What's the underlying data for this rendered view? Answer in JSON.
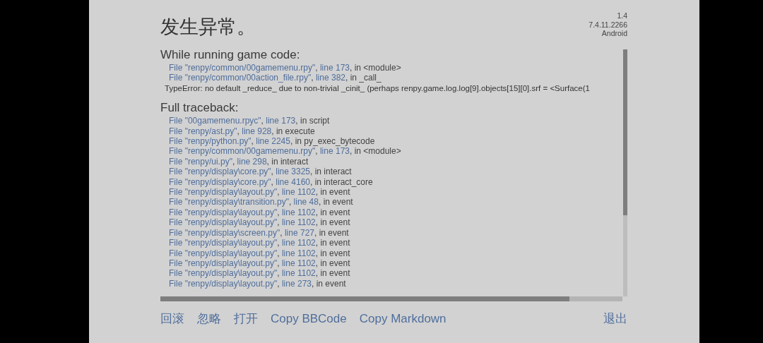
{
  "title": "发生异常。",
  "version_lines": [
    "1.4",
    "7.4.11.2266",
    "Android"
  ],
  "sections": [
    {
      "heading": "While running game code:",
      "frames": [
        {
          "file": "File \"renpy/common/00gamemenu.rpy\"",
          "sep": ", ",
          "line": "line 173",
          "where": ", in <module>"
        },
        {
          "file": "File \"renpy/common/00action_file.rpy\"",
          "sep": ", ",
          "line": "line 382",
          "where": ", in _call_"
        }
      ],
      "message": "TypeError: no default _reduce_ due to non-trivial _cinit_ (perhaps renpy.game.log.log[9].objects[15][0].srf = <Surface(1"
    },
    {
      "heading": "Full traceback:",
      "frames": [
        {
          "file": "File \"00gamemenu.rpyc\"",
          "sep": ", ",
          "line": "line 173",
          "where": ", in script"
        },
        {
          "file": "File \"renpy/ast.py\"",
          "sep": ", ",
          "line": "line 928",
          "where": ", in execute"
        },
        {
          "file": "File \"renpy/python.py\"",
          "sep": ", ",
          "line": "line 2245",
          "where": ", in py_exec_bytecode"
        },
        {
          "file": "File \"renpy/common/00gamemenu.rpy\"",
          "sep": ", ",
          "line": "line 173",
          "where": ", in <module>"
        },
        {
          "file": "File \"renpy/ui.py\"",
          "sep": ", ",
          "line": "line 298",
          "where": ", in interact"
        },
        {
          "file": "File \"renpy/display\\core.py\"",
          "sep": ", ",
          "line": "line 3325",
          "where": ", in interact"
        },
        {
          "file": "File \"renpy/display\\core.py\"",
          "sep": ", ",
          "line": "line 4160",
          "where": ", in interact_core"
        },
        {
          "file": "File \"renpy/display\\layout.py\"",
          "sep": ", ",
          "line": "line 1102",
          "where": ", in event"
        },
        {
          "file": "File \"renpy/display\\transition.py\"",
          "sep": ", ",
          "line": "line 48",
          "where": ", in event"
        },
        {
          "file": "File \"renpy/display\\layout.py\"",
          "sep": ", ",
          "line": "line 1102",
          "where": ", in event"
        },
        {
          "file": "File \"renpy/display\\layout.py\"",
          "sep": ", ",
          "line": "line 1102",
          "where": ", in event"
        },
        {
          "file": "File \"renpy/display\\screen.py\"",
          "sep": ", ",
          "line": "line 727",
          "where": ", in event"
        },
        {
          "file": "File \"renpy/display\\layout.py\"",
          "sep": ", ",
          "line": "line 1102",
          "where": ", in event"
        },
        {
          "file": "File \"renpy/display\\layout.py\"",
          "sep": ", ",
          "line": "line 1102",
          "where": ", in event"
        },
        {
          "file": "File \"renpy/display\\layout.py\"",
          "sep": ", ",
          "line": "line 1102",
          "where": ", in event"
        },
        {
          "file": "File \"renpy/display\\layout.py\"",
          "sep": ", ",
          "line": "line 1102",
          "where": ", in event"
        },
        {
          "file": "File \"renpy/display\\layout.py\"",
          "sep": ", ",
          "line": "line 273",
          "where": ", in event"
        }
      ]
    }
  ],
  "actions": [
    {
      "label": "回滚"
    },
    {
      "label": "忽略"
    },
    {
      "label": "打开"
    },
    {
      "label": "Copy BBCode"
    },
    {
      "label": "Copy Markdown"
    }
  ],
  "quit": "退出"
}
